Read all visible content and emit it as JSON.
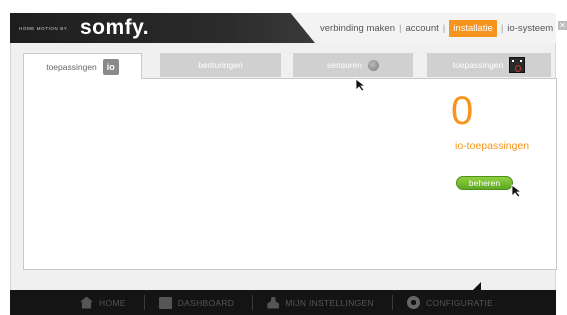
{
  "brand": {
    "tagline": "HOME MOTION BY",
    "logo": "somfy."
  },
  "top_nav": {
    "items": [
      "verbinding maken",
      "account",
      "installatie",
      "io-systeem"
    ],
    "active": "installatie"
  },
  "tabs": [
    {
      "label": "toepassingen",
      "icon": "io-icon",
      "selected": true
    },
    {
      "label": "besturingen",
      "icon": "",
      "selected": false
    },
    {
      "label": "sensoren",
      "icon": "sensor-icon",
      "selected": false
    },
    {
      "label": "toepassingen",
      "icon": "rts-device-icon",
      "selected": false
    }
  ],
  "summary": {
    "count": "0",
    "label": "io-toepassingen",
    "manage_button": "beheren"
  },
  "bottom_nav": {
    "items": [
      {
        "label": "HOME",
        "icon": "home-icon"
      },
      {
        "label": "DASHBOARD",
        "icon": "dashboard-icon"
      },
      {
        "label": "MIJN INSTELLINGEN",
        "icon": "user-icon"
      },
      {
        "label": "CONFIGURATIE",
        "icon": "gear-icon"
      }
    ]
  },
  "colors": {
    "accent": "#f7941d",
    "button_green": "#6db52a",
    "dark_bar": "#141414"
  }
}
